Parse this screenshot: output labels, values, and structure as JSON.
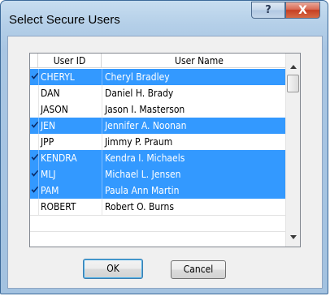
{
  "window": {
    "title": "Select Secure Users",
    "help_glyph": "?",
    "close_glyph": "X"
  },
  "table": {
    "columns": [
      "User ID",
      "User Name"
    ],
    "rows": [
      {
        "id": "CHERYL",
        "name": "Cheryl Bradley",
        "selected": true
      },
      {
        "id": "DAN",
        "name": "Daniel H. Brady",
        "selected": false
      },
      {
        "id": "JASON",
        "name": "Jason I. Masterson",
        "selected": false
      },
      {
        "id": "JEN",
        "name": "Jennifer A. Noonan",
        "selected": true
      },
      {
        "id": "JPP",
        "name": "Jimmy P. Praum",
        "selected": false
      },
      {
        "id": "KENDRA",
        "name": "Kendra I. Michaels",
        "selected": true
      },
      {
        "id": "MLJ",
        "name": "Michael L. Jensen",
        "selected": true
      },
      {
        "id": "PAM",
        "name": "Paula Ann Martin",
        "selected": true
      },
      {
        "id": "ROBERT",
        "name": "Robert O. Burns",
        "selected": false
      }
    ]
  },
  "buttons": {
    "ok": "OK",
    "cancel": "Cancel"
  },
  "colors": {
    "selection": "#3399ff",
    "check": "#0a2a66"
  }
}
